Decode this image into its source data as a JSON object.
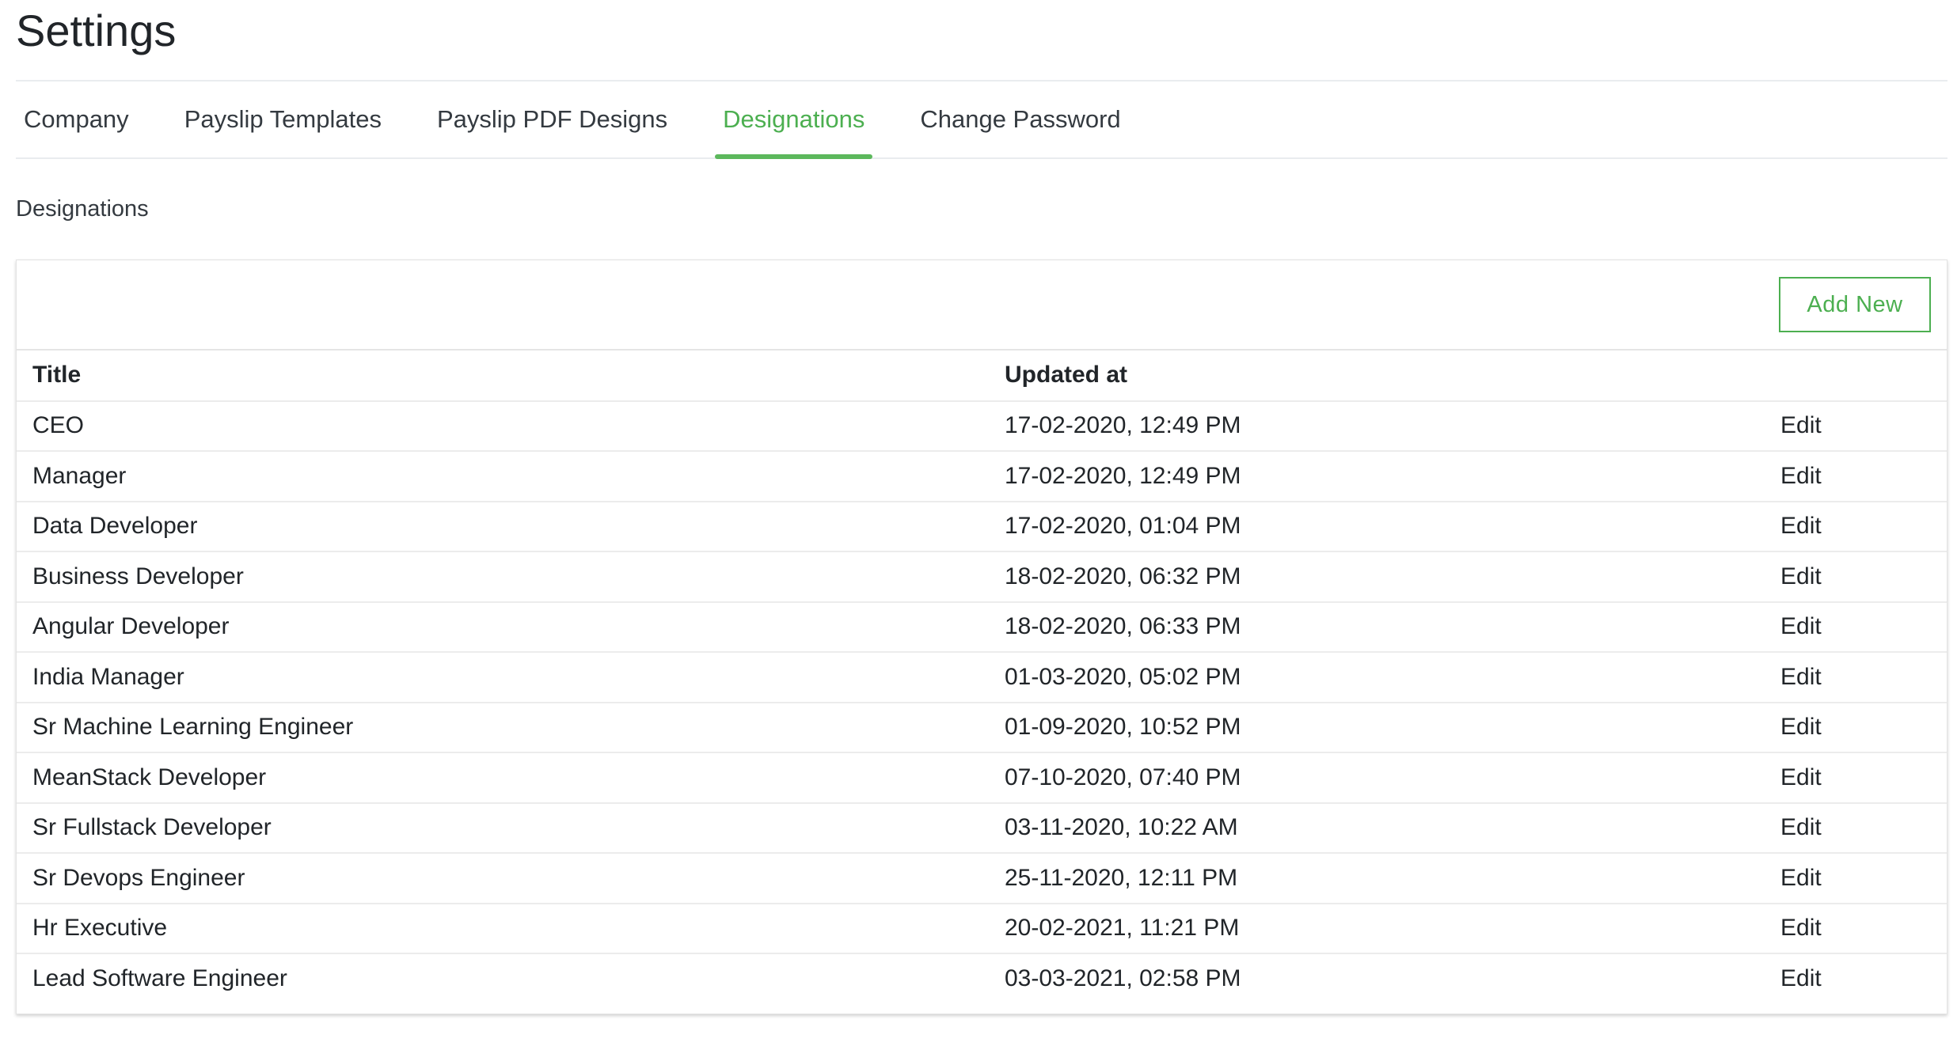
{
  "header": {
    "title": "Settings"
  },
  "tabs": [
    {
      "label": "Company",
      "active": false
    },
    {
      "label": "Payslip Templates",
      "active": false
    },
    {
      "label": "Payslip PDF Designs",
      "active": false
    },
    {
      "label": "Designations",
      "active": true
    },
    {
      "label": "Change Password",
      "active": false
    }
  ],
  "section": {
    "heading": "Designations"
  },
  "toolbar": {
    "add_new_label": "Add New"
  },
  "table": {
    "columns": [
      "Title",
      "Updated at",
      ""
    ],
    "action_label": "Edit",
    "rows": [
      {
        "title": "CEO",
        "updated": "17-02-2020, 12:49 PM"
      },
      {
        "title": "Manager",
        "updated": "17-02-2020, 12:49 PM"
      },
      {
        "title": "Data Developer",
        "updated": "17-02-2020, 01:04 PM"
      },
      {
        "title": "Business Developer",
        "updated": "18-02-2020, 06:32 PM"
      },
      {
        "title": "Angular Developer",
        "updated": "18-02-2020, 06:33 PM"
      },
      {
        "title": "India Manager",
        "updated": "01-03-2020, 05:02 PM"
      },
      {
        "title": "Sr Machine Learning Engineer",
        "updated": "01-09-2020, 10:52 PM"
      },
      {
        "title": "MeanStack Developer",
        "updated": "07-10-2020, 07:40 PM"
      },
      {
        "title": "Sr Fullstack Developer",
        "updated": "03-11-2020, 10:22 AM"
      },
      {
        "title": "Sr Devops Engineer",
        "updated": "25-11-2020, 12:11 PM"
      },
      {
        "title": "Hr Executive",
        "updated": "20-02-2021, 11:21 PM"
      },
      {
        "title": "Lead Software Engineer",
        "updated": "03-03-2021, 02:58 PM"
      }
    ]
  },
  "colors": {
    "accent": "#4caf50",
    "text": "#212529",
    "divider": "#e9ecef"
  }
}
